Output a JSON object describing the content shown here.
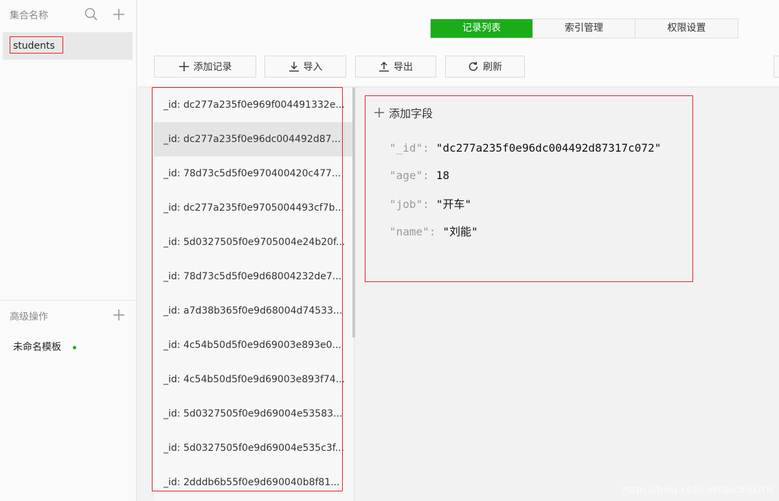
{
  "sidebar": {
    "collections_title": "集合名称",
    "collections": [
      {
        "label": "students"
      }
    ],
    "advanced_title": "高级操作",
    "templates": [
      {
        "label": "未命名模板"
      }
    ]
  },
  "tabs": [
    {
      "label": "记录列表",
      "active": true
    },
    {
      "label": "索引管理",
      "active": false
    },
    {
      "label": "权限设置",
      "active": false
    }
  ],
  "toolbar": {
    "add_label": "添加记录",
    "import_label": "导入",
    "export_label": "导出",
    "refresh_label": "刷新"
  },
  "records": [
    "_id: dc277a235f0e969f004491332e...",
    "_id: dc277a235f0e96dc004492d87...",
    "_id: 78d73c5d5f0e970400420c477...",
    "_id: dc277a235f0e9705004493cf7b...",
    "_id: 5d0327505f0e9705004e24b20f...",
    "_id: 78d73c5d5f0e9d68004232de7...",
    "_id: a7d38b365f0e9d68004d74533...",
    "_id: 4c54b50d5f0e9d69003e893e0...",
    "_id: 4c54b50d5f0e9d69003e893f74...",
    "_id: 5d0327505f0e9d69004e53583...",
    "_id: 5d0327505f0e9d69004e535c3f...",
    "_id: 2dddb6b55f0e9d690040b8f81..."
  ],
  "selected_record_index": 1,
  "detail": {
    "add_field_label": "添加字段",
    "fields": [
      {
        "key": "\"_id\"",
        "value": "\"dc277a235f0e96dc004492d87317c072\""
      },
      {
        "key": "\"age\"",
        "value": "18"
      },
      {
        "key": "\"job\"",
        "value": "\"开车\""
      },
      {
        "key": "\"name\"",
        "value": "\"刘能\""
      }
    ]
  },
  "watermark": "https://blog.csdn.net/JackieDYH",
  "colors": {
    "accent": "#1aad19",
    "highlight_border": "#e02020"
  }
}
